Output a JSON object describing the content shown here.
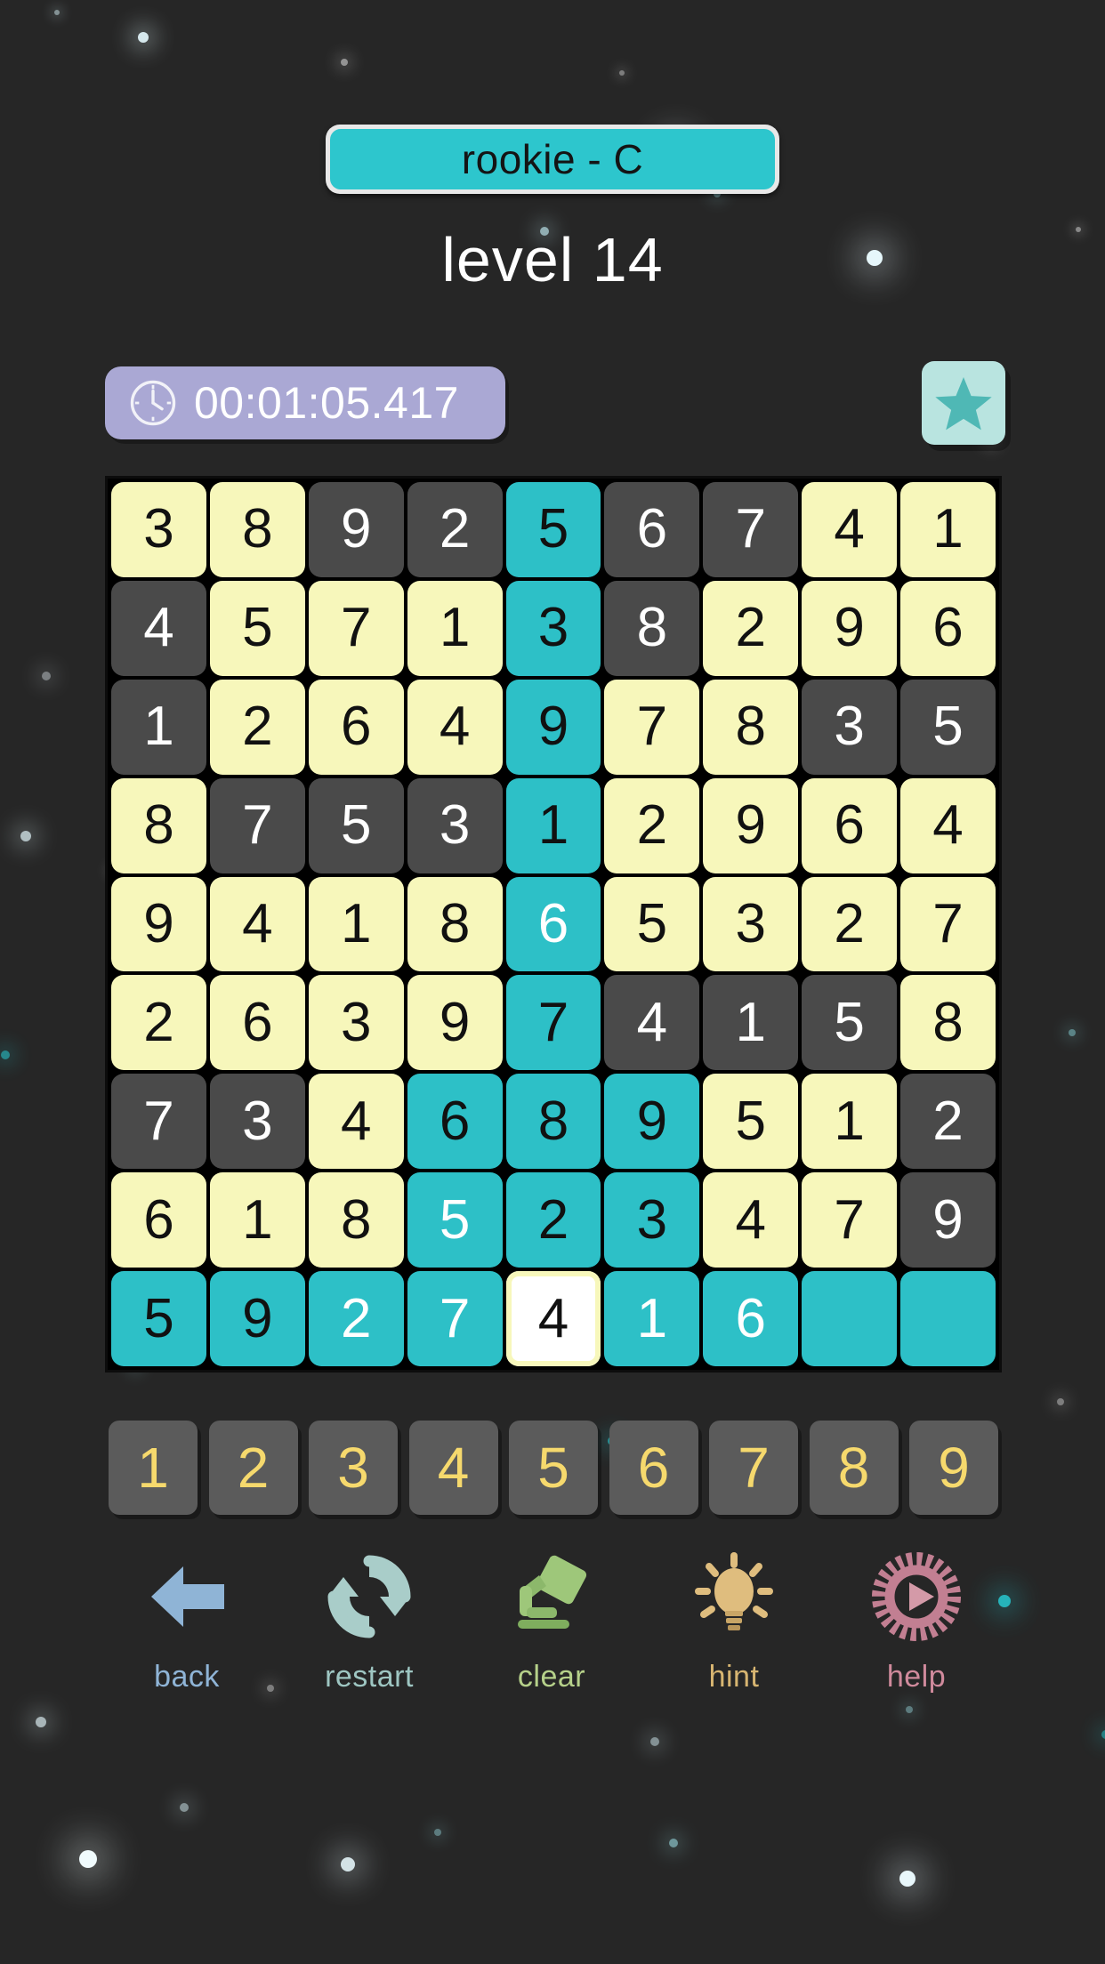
{
  "header": {
    "difficulty_badge": "rookie - C",
    "level_title": "level 14",
    "badge_color": "#2dc6cd"
  },
  "timer": {
    "value": "00:01:05.417",
    "icon": "clock-icon",
    "background_color": "#aaa8d4"
  },
  "star_button": {
    "icon": "star-icon",
    "background_color": "#b9e4e0",
    "star_color": "#4fb8b5"
  },
  "board": {
    "rows": 9,
    "cols": 9,
    "colors": {
      "given_cell": "#f7f7bb",
      "given_text": "#111111",
      "empty_cell": "#4a4a4a",
      "empty_text": "#ffffff",
      "filled_cell": "#2dc0c7",
      "selected_cell": "#ffffff",
      "grid_background": "#000000"
    },
    "cells": [
      [
        {
          "value": "3",
          "state": "given",
          "text": "dark"
        },
        {
          "value": "8",
          "state": "given",
          "text": "dark"
        },
        {
          "value": "9",
          "state": "empty",
          "text": "light"
        },
        {
          "value": "2",
          "state": "empty",
          "text": "light"
        },
        {
          "value": "5",
          "state": "filled",
          "text": "dark"
        },
        {
          "value": "6",
          "state": "empty",
          "text": "light"
        },
        {
          "value": "7",
          "state": "empty",
          "text": "light"
        },
        {
          "value": "4",
          "state": "given",
          "text": "dark"
        },
        {
          "value": "1",
          "state": "given",
          "text": "dark"
        }
      ],
      [
        {
          "value": "4",
          "state": "empty",
          "text": "light"
        },
        {
          "value": "5",
          "state": "given",
          "text": "dark"
        },
        {
          "value": "7",
          "state": "given",
          "text": "dark"
        },
        {
          "value": "1",
          "state": "given",
          "text": "dark"
        },
        {
          "value": "3",
          "state": "filled",
          "text": "dark"
        },
        {
          "value": "8",
          "state": "empty",
          "text": "light"
        },
        {
          "value": "2",
          "state": "given",
          "text": "dark"
        },
        {
          "value": "9",
          "state": "given",
          "text": "dark"
        },
        {
          "value": "6",
          "state": "given",
          "text": "dark"
        }
      ],
      [
        {
          "value": "1",
          "state": "empty",
          "text": "light"
        },
        {
          "value": "2",
          "state": "given",
          "text": "dark"
        },
        {
          "value": "6",
          "state": "given",
          "text": "dark"
        },
        {
          "value": "4",
          "state": "given",
          "text": "dark"
        },
        {
          "value": "9",
          "state": "filled",
          "text": "dark"
        },
        {
          "value": "7",
          "state": "given",
          "text": "dark"
        },
        {
          "value": "8",
          "state": "given",
          "text": "dark"
        },
        {
          "value": "3",
          "state": "empty",
          "text": "light"
        },
        {
          "value": "5",
          "state": "empty",
          "text": "light"
        }
      ],
      [
        {
          "value": "8",
          "state": "given",
          "text": "dark"
        },
        {
          "value": "7",
          "state": "empty",
          "text": "light"
        },
        {
          "value": "5",
          "state": "empty",
          "text": "light"
        },
        {
          "value": "3",
          "state": "empty",
          "text": "light"
        },
        {
          "value": "1",
          "state": "filled",
          "text": "dark"
        },
        {
          "value": "2",
          "state": "given",
          "text": "dark"
        },
        {
          "value": "9",
          "state": "given",
          "text": "dark"
        },
        {
          "value": "6",
          "state": "given",
          "text": "dark"
        },
        {
          "value": "4",
          "state": "given",
          "text": "dark"
        }
      ],
      [
        {
          "value": "9",
          "state": "given",
          "text": "dark"
        },
        {
          "value": "4",
          "state": "given",
          "text": "dark"
        },
        {
          "value": "1",
          "state": "given",
          "text": "dark"
        },
        {
          "value": "8",
          "state": "given",
          "text": "dark"
        },
        {
          "value": "6",
          "state": "filled",
          "text": "light"
        },
        {
          "value": "5",
          "state": "given",
          "text": "dark"
        },
        {
          "value": "3",
          "state": "given",
          "text": "dark"
        },
        {
          "value": "2",
          "state": "given",
          "text": "dark"
        },
        {
          "value": "7",
          "state": "given",
          "text": "dark"
        }
      ],
      [
        {
          "value": "2",
          "state": "given",
          "text": "dark"
        },
        {
          "value": "6",
          "state": "given",
          "text": "dark"
        },
        {
          "value": "3",
          "state": "given",
          "text": "dark"
        },
        {
          "value": "9",
          "state": "given",
          "text": "dark"
        },
        {
          "value": "7",
          "state": "filled",
          "text": "dark"
        },
        {
          "value": "4",
          "state": "empty",
          "text": "light"
        },
        {
          "value": "1",
          "state": "empty",
          "text": "light"
        },
        {
          "value": "5",
          "state": "empty",
          "text": "light"
        },
        {
          "value": "8",
          "state": "given",
          "text": "dark"
        }
      ],
      [
        {
          "value": "7",
          "state": "empty",
          "text": "light"
        },
        {
          "value": "3",
          "state": "empty",
          "text": "light"
        },
        {
          "value": "4",
          "state": "given",
          "text": "dark"
        },
        {
          "value": "6",
          "state": "filled",
          "text": "dark"
        },
        {
          "value": "8",
          "state": "filled",
          "text": "dark"
        },
        {
          "value": "9",
          "state": "filled",
          "text": "dark"
        },
        {
          "value": "5",
          "state": "given",
          "text": "dark"
        },
        {
          "value": "1",
          "state": "given",
          "text": "dark"
        },
        {
          "value": "2",
          "state": "empty",
          "text": "light"
        }
      ],
      [
        {
          "value": "6",
          "state": "given",
          "text": "dark"
        },
        {
          "value": "1",
          "state": "given",
          "text": "dark"
        },
        {
          "value": "8",
          "state": "given",
          "text": "dark"
        },
        {
          "value": "5",
          "state": "filled",
          "text": "light"
        },
        {
          "value": "2",
          "state": "filled",
          "text": "dark"
        },
        {
          "value": "3",
          "state": "filled",
          "text": "dark"
        },
        {
          "value": "4",
          "state": "given",
          "text": "dark"
        },
        {
          "value": "7",
          "state": "given",
          "text": "dark"
        },
        {
          "value": "9",
          "state": "empty",
          "text": "light"
        }
      ],
      [
        {
          "value": "5",
          "state": "filled",
          "text": "dark"
        },
        {
          "value": "9",
          "state": "filled",
          "text": "dark"
        },
        {
          "value": "2",
          "state": "filled",
          "text": "light"
        },
        {
          "value": "7",
          "state": "filled",
          "text": "light"
        },
        {
          "value": "4",
          "state": "selected",
          "text": "dark"
        },
        {
          "value": "1",
          "state": "filled",
          "text": "light"
        },
        {
          "value": "6",
          "state": "filled",
          "text": "light"
        },
        {
          "value": "",
          "state": "blank",
          "text": "dark"
        },
        {
          "value": "",
          "state": "blank",
          "text": "dark"
        }
      ]
    ]
  },
  "numpad": {
    "keys": [
      "1",
      "2",
      "3",
      "4",
      "5",
      "6",
      "7",
      "8",
      "9"
    ],
    "key_color": "#5b5b5b",
    "digit_color": "#f6d96d"
  },
  "toolbar": {
    "items": [
      {
        "label": "back",
        "icon": "back-arrow-icon",
        "color": "#8fb4d6"
      },
      {
        "label": "restart",
        "icon": "refresh-icon",
        "color": "#9ec6c2"
      },
      {
        "label": "clear",
        "icon": "eraser-icon",
        "color": "#b6d18a"
      },
      {
        "label": "hint",
        "icon": "lightbulb-icon",
        "color": "#d7b571"
      },
      {
        "label": "help",
        "icon": "play-gear-icon",
        "color": "#d08a9c"
      }
    ]
  }
}
